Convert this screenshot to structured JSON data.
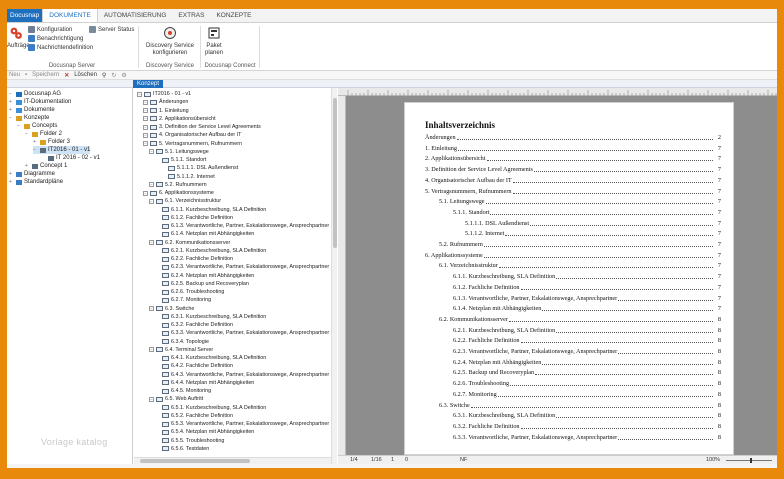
{
  "tabs": [
    "Docusnap",
    "DOKUMENTE",
    "AUTOMATISIERUNG",
    "EXTRAS",
    "KONZEPTE"
  ],
  "ribbon": {
    "left_large": "Aufträge",
    "small": [
      "Konfiguration",
      "Benachrichtigung",
      "Nachrichtendefinition",
      "Server Status"
    ],
    "docusnap_server": "Docusnap Server",
    "discovery_btn_1": "Discovery Service",
    "discovery_btn_2": "konfigurieren",
    "discovery_group": "Discovery Service",
    "paket_btn_1": "Paket",
    "paket_btn_2": "planen",
    "connect_group": "Docusnap Connect"
  },
  "quickbar": {
    "neu": "Neu",
    "speichern": "Speichern",
    "loeschen": "Löschen"
  },
  "panel_tab": "Konzept",
  "left_tree": [
    {
      "label": "Docusnap AG",
      "indent": 0,
      "exp": "−"
    },
    {
      "label": "IT-Dokumentation",
      "indent": 0,
      "exp": "+"
    },
    {
      "label": "Dokumente",
      "indent": 0,
      "exp": "+"
    },
    {
      "label": "Konzepte",
      "indent": 0,
      "exp": "−"
    },
    {
      "label": "Concepts",
      "indent": 1,
      "exp": "−"
    },
    {
      "label": "Folder 2",
      "indent": 2,
      "exp": "−"
    },
    {
      "label": "Folder 3",
      "indent": 3,
      "exp": "+"
    },
    {
      "label": "IT2016 - 01 - v1",
      "indent": 3,
      "exp": "−",
      "selected": true
    },
    {
      "label": "IT 2016 - 02 - v1",
      "indent": 4,
      "exp": ""
    },
    {
      "label": "Concept 1",
      "indent": 2,
      "exp": "+"
    },
    {
      "label": "Diagramme",
      "indent": 0,
      "exp": "+"
    },
    {
      "label": "Standardpläne",
      "indent": 0,
      "exp": "+"
    }
  ],
  "watermark": "Vorlage katalog",
  "doc_tree": [
    {
      "label": "IT2016 - 01 - v1",
      "indent": 0
    },
    {
      "label": "Änderungen",
      "indent": 1
    },
    {
      "label": "1. Einleitung",
      "indent": 1
    },
    {
      "label": "2. Applikationsübersicht",
      "indent": 1
    },
    {
      "label": "3. Definition der Service Level Agreements",
      "indent": 1
    },
    {
      "label": "4. Organisatorischer Aufbau der IT",
      "indent": 1
    },
    {
      "label": "5. Vertragsnummern, Rufnummern",
      "indent": 1
    },
    {
      "label": "5.1. Leitungswege",
      "indent": 2
    },
    {
      "label": "5.1.1. Standort",
      "indent": 3
    },
    {
      "label": "5.1.1.1. DSL Außendienst",
      "indent": 4
    },
    {
      "label": "5.1.1.2. Internet",
      "indent": 4
    },
    {
      "label": "5.2. Rufnummern",
      "indent": 2
    },
    {
      "label": "6. Applikationssysteme",
      "indent": 1
    },
    {
      "label": "6.1. Verzeichnisstruktur",
      "indent": 2
    },
    {
      "label": "6.1.1. Kurzbeschreibung, SLA Definition",
      "indent": 3
    },
    {
      "label": "6.1.2. Fachliche Definition",
      "indent": 3
    },
    {
      "label": "6.1.3. Verantwortliche, Partner, Eskalationswege, Ansprechpartner",
      "indent": 3
    },
    {
      "label": "6.1.4. Netzplan mit Abhängigkeiten",
      "indent": 3
    },
    {
      "label": "6.2. Kommunikationsserver",
      "indent": 2
    },
    {
      "label": "6.2.1. Kurzbeschreibung, SLA Definition",
      "indent": 3
    },
    {
      "label": "6.2.2. Fachliche Definition",
      "indent": 3
    },
    {
      "label": "6.2.3. Verantwortliche, Partner, Eskalationswege, Ansprechpartner",
      "indent": 3
    },
    {
      "label": "6.2.4. Netzplan mit Abhängigkeiten",
      "indent": 3
    },
    {
      "label": "6.2.5. Backup und Recoveryplan",
      "indent": 3
    },
    {
      "label": "6.2.6. Troubleshooting",
      "indent": 3
    },
    {
      "label": "6.2.7. Monitoring",
      "indent": 3
    },
    {
      "label": "6.3. Switche",
      "indent": 2
    },
    {
      "label": "6.3.1. Kurzbeschreibung, SLA Definition",
      "indent": 3
    },
    {
      "label": "6.3.2. Fachliche Definition",
      "indent": 3
    },
    {
      "label": "6.3.3. Verantwortliche, Partner, Eskalationswege, Ansprechpartner",
      "indent": 3
    },
    {
      "label": "6.3.4. Topologie",
      "indent": 3
    },
    {
      "label": "6.4. Terminal Server",
      "indent": 2
    },
    {
      "label": "6.4.1. Kurzbeschreibung, SLA Definition",
      "indent": 3
    },
    {
      "label": "6.4.2. Fachliche Definition",
      "indent": 3
    },
    {
      "label": "6.4.3. Verantwortliche, Partner, Eskalationswege, Ansprechpartner",
      "indent": 3
    },
    {
      "label": "6.4.4. Netzplan mit Abhängigkeiten",
      "indent": 3
    },
    {
      "label": "6.4.5. Monitoring",
      "indent": 3
    },
    {
      "label": "6.5. Web Auftritt",
      "indent": 2
    },
    {
      "label": "6.5.1. Kurzbeschreibung, SLA Definition",
      "indent": 3
    },
    {
      "label": "6.5.2. Fachliche Definition",
      "indent": 3
    },
    {
      "label": "6.5.3. Verantwortliche, Partner, Eskalationswege, Ansprechpartner",
      "indent": 3
    },
    {
      "label": "6.5.4. Netzplan mit Abhängigkeiten",
      "indent": 3
    },
    {
      "label": "6.5.5. Troubleshooting",
      "indent": 3
    },
    {
      "label": "6.5.6. Testdaten",
      "indent": 3
    }
  ],
  "toc": {
    "title": "Inhaltsverzeichnis",
    "entries": [
      {
        "text": "Änderungen",
        "page": "2",
        "level": 0
      },
      {
        "text": "1. Einleitung",
        "page": "7",
        "level": 0
      },
      {
        "text": "2. Applikationsübersicht",
        "page": "7",
        "level": 0
      },
      {
        "text": "3. Definition der Service Level Agreements",
        "page": "7",
        "level": 0
      },
      {
        "text": "4. Organisatorischer Aufbau der IT",
        "page": "7",
        "level": 0
      },
      {
        "text": "5. Vertragsnummern, Rufnummern",
        "page": "7",
        "level": 0
      },
      {
        "text": "5.1. Leitungswege",
        "page": "7",
        "level": 1
      },
      {
        "text": "5.1.1. Standort",
        "page": "7",
        "level": 2
      },
      {
        "text": "5.1.1.1. DSL Außendienst",
        "page": "7",
        "level": 3
      },
      {
        "text": "5.1.1.2. Internet",
        "page": "7",
        "level": 3
      },
      {
        "text": "5.2. Rufnummern",
        "page": "7",
        "level": 1
      },
      {
        "text": "6. Applikationssysteme",
        "page": "7",
        "level": 0
      },
      {
        "text": "6.1. Verzeichnisstruktur",
        "page": "7",
        "level": 1
      },
      {
        "text": "6.1.1. Kurzbeschreibung, SLA Definition",
        "page": "7",
        "level": 2
      },
      {
        "text": "6.1.2. Fachliche Definition",
        "page": "7",
        "level": 2
      },
      {
        "text": "6.1.3. Verantwortliche, Partner, Eskalationswege, Ansprechpartner",
        "page": "7",
        "level": 2
      },
      {
        "text": "6.1.4. Netzplan mit Abhängigkeiten",
        "page": "7",
        "level": 2
      },
      {
        "text": "6.2. Kommunikationsserver",
        "page": "8",
        "level": 1
      },
      {
        "text": "6.2.1. Kurzbeschreibung, SLA Definition",
        "page": "8",
        "level": 2
      },
      {
        "text": "6.2.2. Fachliche Definition",
        "page": "8",
        "level": 2
      },
      {
        "text": "6.2.3. Verantwortliche, Partner, Eskalationswege, Ansprechpartner",
        "page": "8",
        "level": 2
      },
      {
        "text": "6.2.4. Netzplan mit Abhängigkeiten",
        "page": "8",
        "level": 2
      },
      {
        "text": "6.2.5. Backup und Recoveryplan",
        "page": "8",
        "level": 2
      },
      {
        "text": "6.2.6. Troubleshooting",
        "page": "8",
        "level": 2
      },
      {
        "text": "6.2.7. Monitoring",
        "page": "8",
        "level": 2
      },
      {
        "text": "6.3. Switche",
        "page": "8",
        "level": 1
      },
      {
        "text": "6.3.1. Kurzbeschreibung, SLA Definition",
        "page": "8",
        "level": 2
      },
      {
        "text": "6.3.2. Fachliche Definition",
        "page": "8",
        "level": 2
      },
      {
        "text": "6.3.3. Verantwortliche, Partner, Eskalationswege, Ansprechpartner",
        "page": "8",
        "level": 2
      }
    ]
  },
  "status": {
    "page": "1/4",
    "pages": "1/16",
    "col": "1",
    "line": "0",
    "mode": "NF",
    "zoom": "100%"
  },
  "colors": {
    "accent": "#1f6fbf",
    "frame": "#e8890c"
  }
}
